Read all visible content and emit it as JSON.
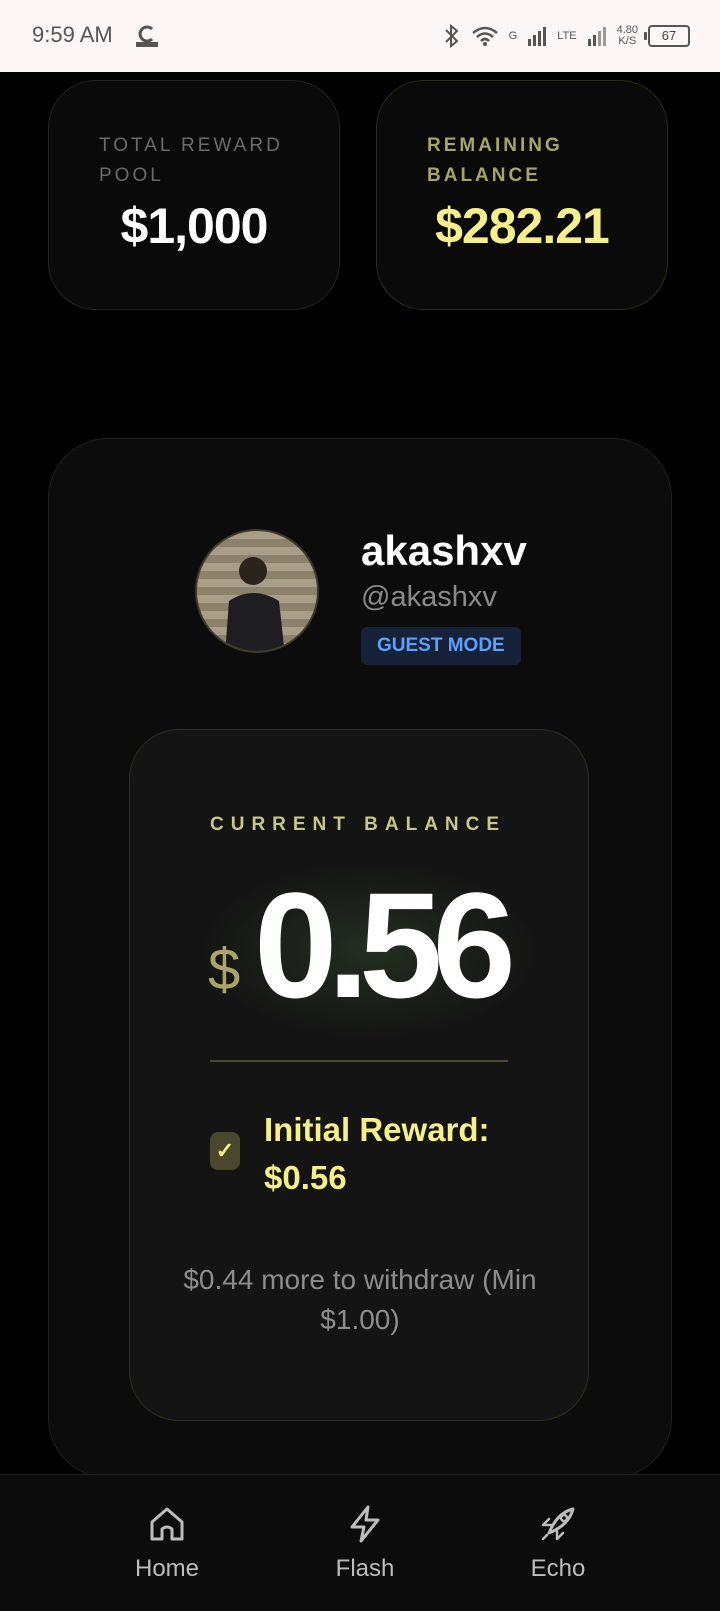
{
  "status_bar": {
    "time": "9:59 AM",
    "network_speed_value": "4.80",
    "network_speed_unit": "K/S",
    "network_g": "G",
    "network_lte": "LTE",
    "battery": "67"
  },
  "stats": {
    "total_reward_pool_label": "TOTAL REWARD POOL",
    "total_reward_pool_value": "$1,000",
    "remaining_balance_label": "REMAINING BALANCE",
    "remaining_balance_value": "$282.21"
  },
  "profile": {
    "username": "akashxv",
    "handle": "@akashxv",
    "badge": "GUEST MODE"
  },
  "balance": {
    "label": "CURRENT BALANCE",
    "currency": "$",
    "amount": "0.56",
    "reward_label": "Initial Reward: $0.56",
    "withdraw_note": "$0.44 more to withdraw (Min $1.00)"
  },
  "nav": {
    "items": [
      {
        "label": "Home",
        "icon": "home-icon"
      },
      {
        "label": "Flash",
        "icon": "lightning-icon"
      },
      {
        "label": "Echo",
        "icon": "rocket-icon"
      }
    ]
  },
  "colors": {
    "accent_yellow": "#f6f08c",
    "badge_blue": "#5ea0ff",
    "background": "#000000"
  }
}
